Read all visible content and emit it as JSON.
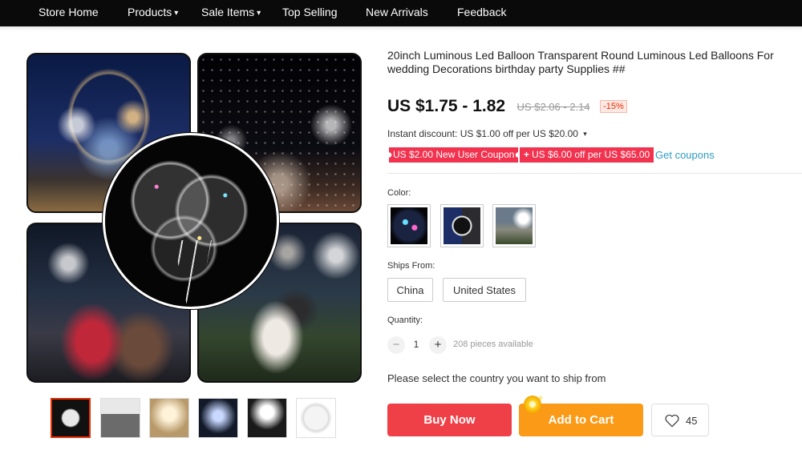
{
  "nav": {
    "items": [
      {
        "label": "Store Home",
        "dropdown": false
      },
      {
        "label": "Products",
        "dropdown": true
      },
      {
        "label": "Sale Items",
        "dropdown": true
      },
      {
        "label": "Top Selling",
        "dropdown": false
      },
      {
        "label": "New Arrivals",
        "dropdown": false
      },
      {
        "label": "Feedback",
        "dropdown": false
      }
    ]
  },
  "product": {
    "title": "20inch Luminous Led Balloon Transparent Round Luminous Led Balloons For wedding Decorations birthday party Supplies ##",
    "price": "US $1.75 - 1.82",
    "original_price": "US $2.06 - 2.14",
    "discount": "-15%",
    "instant_discount": "Instant discount: US $1.00 off per US $20.00",
    "coupons": [
      {
        "text": "US $2.00 New User Coupon"
      },
      {
        "text": "US $6.00 off per US $65.00",
        "prefix": "+"
      }
    ],
    "get_coupons": "Get coupons",
    "color_label": "Color:",
    "ships_from_label": "Ships From:",
    "ships_from_options": [
      "China",
      "United States"
    ],
    "quantity_label": "Quantity:",
    "quantity": "1",
    "qty_minus": "−",
    "qty_plus": "+",
    "available": "208 pieces available",
    "ship_note": "Please select the country you want to ship from",
    "buy_now": "Buy Now",
    "add_to_cart": "Add to Cart",
    "wishlist_count": "45"
  },
  "colors": {
    "nav_bg": "#0a0a0a",
    "buy_now": "#ef4048",
    "add_to_cart": "#fa9a16",
    "coupon": "#f2334f",
    "link": "#2e9cc3",
    "discount": "#e62e04"
  }
}
